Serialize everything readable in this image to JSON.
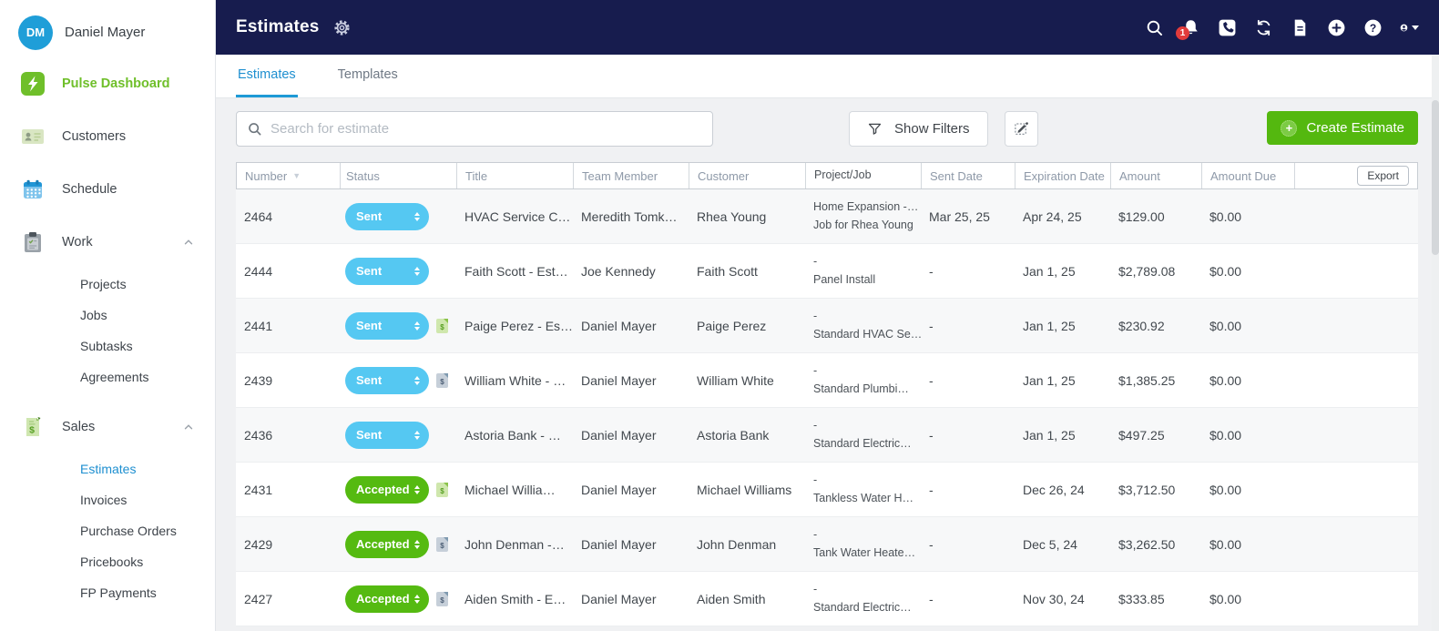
{
  "user": {
    "initials": "DM",
    "name": "Daniel Mayer"
  },
  "header": {
    "title": "Estimates",
    "notification_count": "1"
  },
  "sidebar": {
    "dashboard": "Pulse Dashboard",
    "customers": "Customers",
    "schedule": "Schedule",
    "work": {
      "label": "Work",
      "children": {
        "projects": "Projects",
        "jobs": "Jobs",
        "subtasks": "Subtasks",
        "agreements": "Agreements"
      }
    },
    "sales": {
      "label": "Sales",
      "children": {
        "estimates": "Estimates",
        "invoices": "Invoices",
        "purchase_orders": "Purchase Orders",
        "pricebooks": "Pricebooks",
        "fp_payments": "FP Payments"
      }
    }
  },
  "tabs": {
    "estimates": "Estimates",
    "templates": "Templates"
  },
  "toolbar": {
    "search_placeholder": "Search for estimate",
    "show_filters_label": "Show Filters",
    "create_estimate_label": "Create Estimate"
  },
  "table": {
    "headers": {
      "number": "Number",
      "status": "Status",
      "title": "Title",
      "team_member": "Team Member",
      "customer": "Customer",
      "project_job": "Project/Job",
      "sent_date": "Sent Date",
      "expiration_date": "Expiration Date",
      "amount": "Amount",
      "amount_due": "Amount Due",
      "export_label": "Export"
    },
    "rows": [
      {
        "number": "2464",
        "status": "Sent",
        "status_class": "sent",
        "doc_icon": "none",
        "title": "HVAC Service C…",
        "team_member": "Meredith Tomk…",
        "customer": "Rhea Young",
        "project": "Home Expansion -…",
        "job": "Job for Rhea Young",
        "sent_date": "Mar 25, 25",
        "expiration_date": "Apr 24, 25",
        "amount": "$129.00",
        "amount_due": "$0.00"
      },
      {
        "number": "2444",
        "status": "Sent",
        "status_class": "sent",
        "doc_icon": "none",
        "title": "Faith Scott - Est…",
        "team_member": "Joe Kennedy",
        "customer": "Faith Scott",
        "project": "-",
        "job": "Panel Install",
        "sent_date": "-",
        "expiration_date": "Jan 1, 25",
        "amount": "$2,789.08",
        "amount_due": "$0.00"
      },
      {
        "number": "2441",
        "status": "Sent",
        "status_class": "sent",
        "doc_icon": "green",
        "title": "Paige Perez - Es…",
        "team_member": "Daniel Mayer",
        "customer": "Paige Perez",
        "project": "-",
        "job": "Standard HVAC Se…",
        "sent_date": "-",
        "expiration_date": "Jan 1, 25",
        "amount": "$230.92",
        "amount_due": "$0.00"
      },
      {
        "number": "2439",
        "status": "Sent",
        "status_class": "sent",
        "doc_icon": "gray",
        "title": "William White - …",
        "team_member": "Daniel Mayer",
        "customer": "William White",
        "project": "-",
        "job": "Standard Plumbi…",
        "sent_date": "-",
        "expiration_date": "Jan 1, 25",
        "amount": "$1,385.25",
        "amount_due": "$0.00"
      },
      {
        "number": "2436",
        "status": "Sent",
        "status_class": "sent",
        "doc_icon": "none",
        "title": "Astoria Bank - …",
        "team_member": "Daniel Mayer",
        "customer": "Astoria Bank",
        "project": "-",
        "job": "Standard Electric…",
        "sent_date": "-",
        "expiration_date": "Jan 1, 25",
        "amount": "$497.25",
        "amount_due": "$0.00"
      },
      {
        "number": "2431",
        "status": "Accepted",
        "status_class": "accepted",
        "doc_icon": "green",
        "title": "Michael Willia…",
        "team_member": "Daniel Mayer",
        "customer": "Michael Williams",
        "project": "-",
        "job": "Tankless Water H…",
        "sent_date": "-",
        "expiration_date": "Dec 26, 24",
        "amount": "$3,712.50",
        "amount_due": "$0.00"
      },
      {
        "number": "2429",
        "status": "Accepted",
        "status_class": "accepted",
        "doc_icon": "gray",
        "title": "John Denman -…",
        "team_member": "Daniel Mayer",
        "customer": "John Denman",
        "project": "-",
        "job": "Tank Water Heate…",
        "sent_date": "-",
        "expiration_date": "Dec 5, 24",
        "amount": "$3,262.50",
        "amount_due": "$0.00"
      },
      {
        "number": "2427",
        "status": "Accepted",
        "status_class": "accepted",
        "doc_icon": "gray",
        "title": "Aiden Smith - E…",
        "team_member": "Daniel Mayer",
        "customer": "Aiden Smith",
        "project": "-",
        "job": "Standard Electric…",
        "sent_date": "-",
        "expiration_date": "Nov 30, 24",
        "amount": "$333.85",
        "amount_due": "$0.00"
      }
    ]
  },
  "colors": {
    "topbar_navy": "#171c4e",
    "accent_blue": "#1e8fd0",
    "sent_blue": "#55c8f2",
    "accepted_green": "#55ba11",
    "button_green": "#54b80f",
    "brand_green": "#6fbf2a",
    "notification_red": "#e23b3b"
  }
}
